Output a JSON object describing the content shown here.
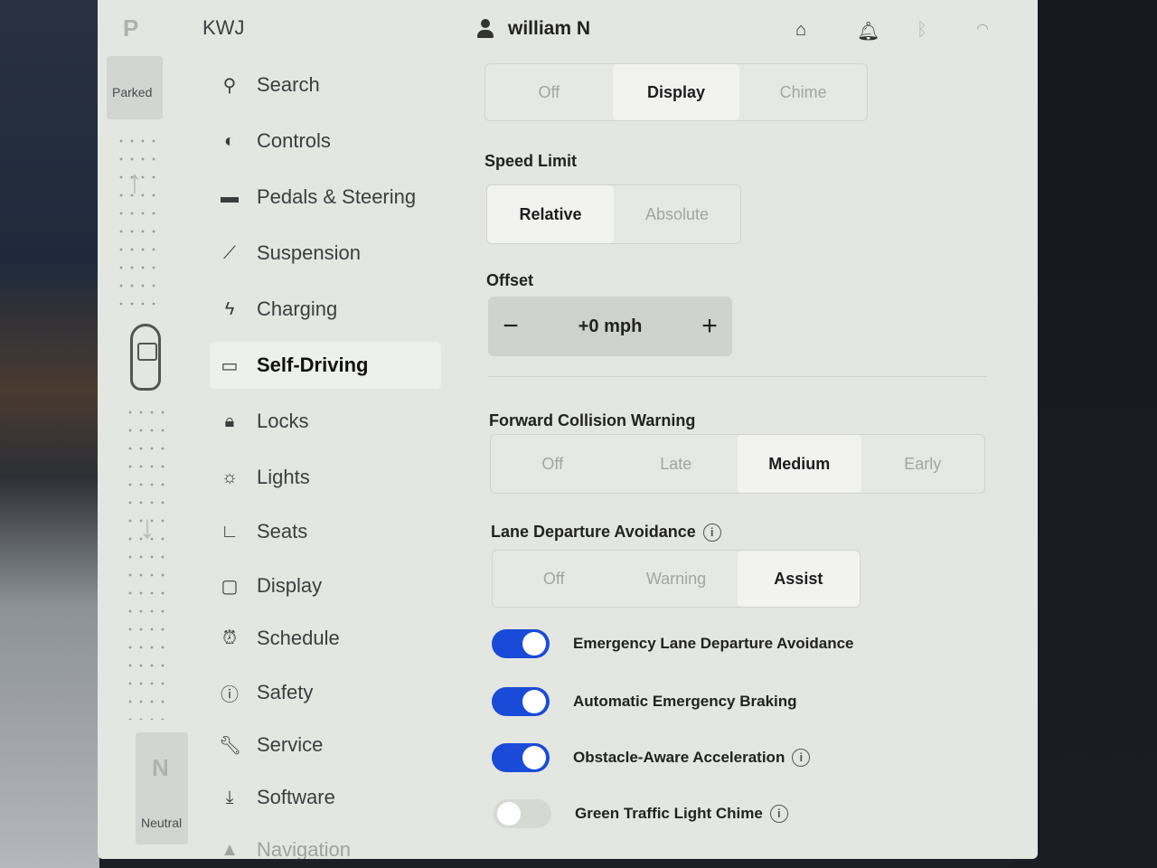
{
  "gear": {
    "top_letter": "P",
    "top_label": "Parked",
    "bottom_letter": "N",
    "bottom_label": "Neutral"
  },
  "status_bar": {
    "vehicle_name": "KWJ",
    "user_name": "william N",
    "icons": [
      "user-icon",
      "garage-icon",
      "bell-icon",
      "bluetooth-icon",
      "wifi-icon"
    ]
  },
  "nav": {
    "items": [
      {
        "label": "Search",
        "icon": "search-icon"
      },
      {
        "label": "Controls",
        "icon": "toggle-icon"
      },
      {
        "label": "Pedals & Steering",
        "icon": "car-icon"
      },
      {
        "label": "Suspension",
        "icon": "wrench-icon"
      },
      {
        "label": "Charging",
        "icon": "bolt-icon"
      },
      {
        "label": "Self-Driving",
        "icon": "steering-icon",
        "selected": true
      },
      {
        "label": "Locks",
        "icon": "lock-icon"
      },
      {
        "label": "Lights",
        "icon": "sun-icon"
      },
      {
        "label": "Seats",
        "icon": "seat-icon"
      },
      {
        "label": "Display",
        "icon": "display-icon"
      },
      {
        "label": "Schedule",
        "icon": "alarm-icon"
      },
      {
        "label": "Safety",
        "icon": "alert-icon"
      },
      {
        "label": "Service",
        "icon": "wrench-icon"
      },
      {
        "label": "Software",
        "icon": "download-icon"
      },
      {
        "label": "Navigation",
        "icon": "navigation-icon"
      }
    ]
  },
  "content": {
    "alert_options": [
      "Off",
      "Display",
      "Chime"
    ],
    "alert_selected": "Display",
    "speed_limit": {
      "label": "Speed Limit",
      "options": [
        "Relative",
        "Absolute"
      ],
      "selected": "Relative"
    },
    "offset": {
      "label": "Offset",
      "minus": "−",
      "value": "+0 mph",
      "plus": "+"
    },
    "fcw": {
      "label": "Forward Collision Warning",
      "options": [
        "Off",
        "Late",
        "Medium",
        "Early"
      ],
      "selected": "Medium"
    },
    "lda": {
      "label": "Lane Departure Avoidance",
      "options": [
        "Off",
        "Warning",
        "Assist"
      ],
      "selected": "Assist"
    },
    "toggles": [
      {
        "label": "Emergency Lane Departure Avoidance",
        "on": true,
        "info": false
      },
      {
        "label": "Automatic Emergency Braking",
        "on": true,
        "info": false
      },
      {
        "label": "Obstacle-Aware Acceleration",
        "on": true,
        "info": true
      },
      {
        "label": "Green Traffic Light Chime",
        "on": false,
        "info": true
      }
    ],
    "info_glyph": "i"
  },
  "colors": {
    "accent": "#1a4bd8",
    "screen_bg": "#e3e6e1"
  }
}
